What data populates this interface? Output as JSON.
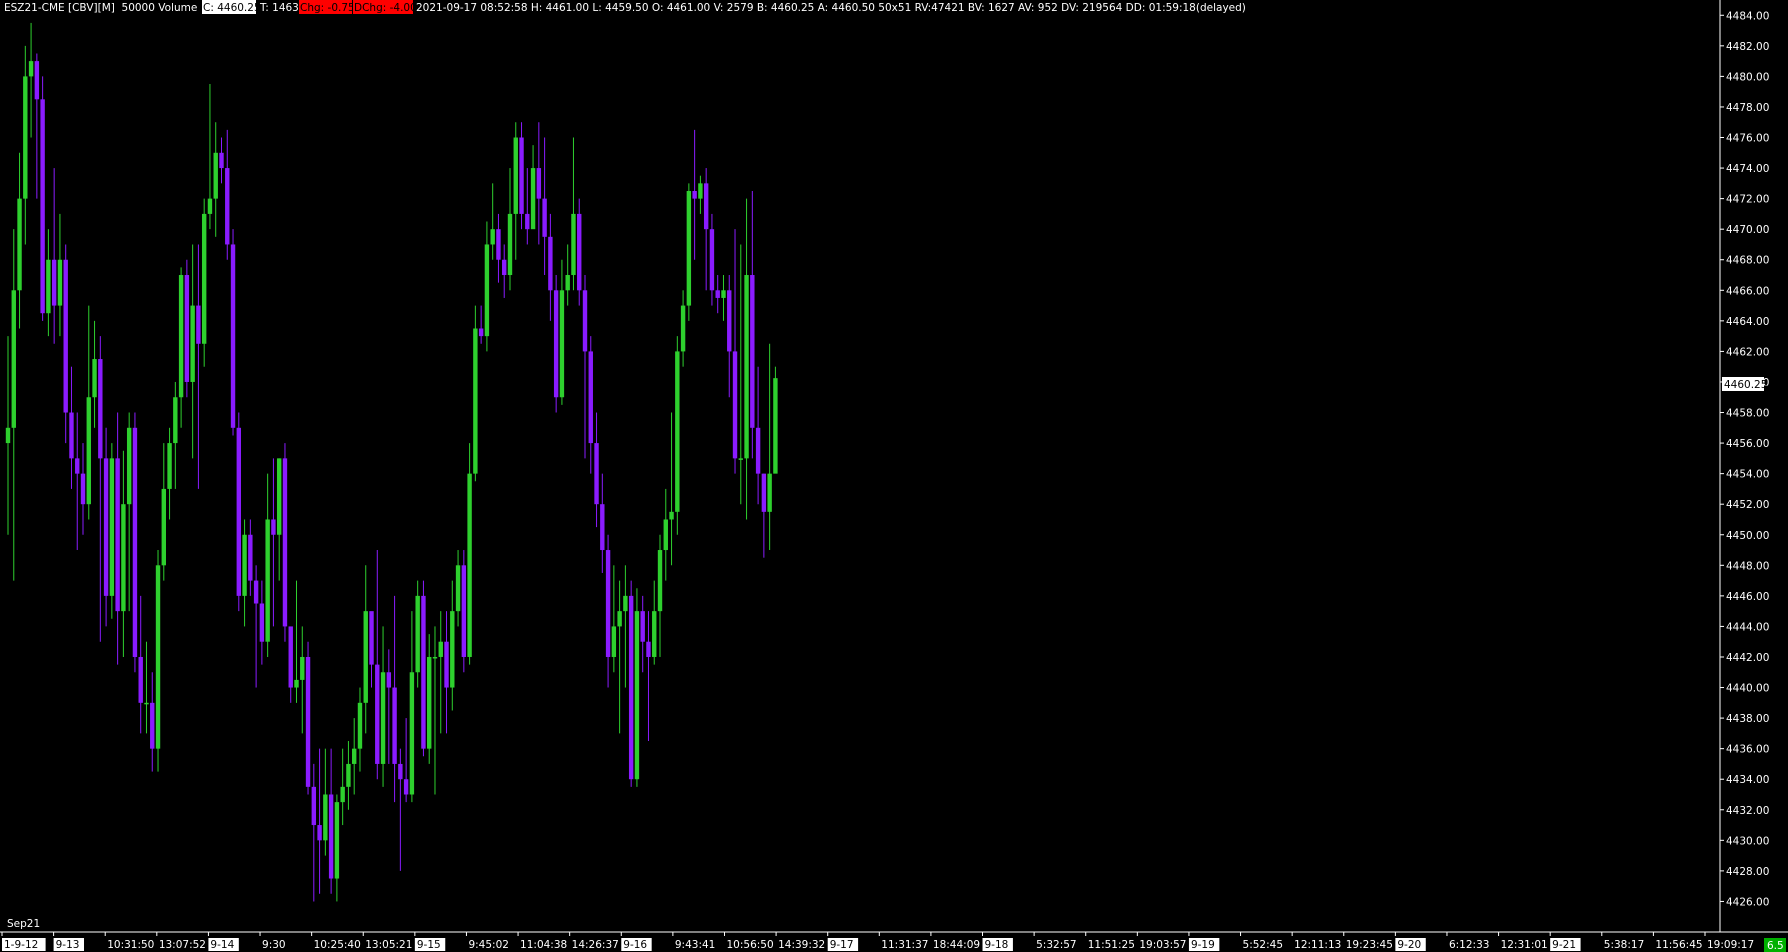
{
  "header": {
    "symbol": "ESZ21-CME [CBV][M]  50000 Volume  #3",
    "last": "C: 4460.25",
    "trades": "T: 1463",
    "chg": "Chg: -0.75",
    "dchg": "DChg: -4.00",
    "details": "2021-09-17 08:52:58 H: 4461.00 L: 4459.50 O: 4461.00 V: 2579 B: 4460.25 A: 4460.50 50x51 RV:47421 BV: 1627 AV: 952 DV: 219564 DD: 01:59:18(delayed)"
  },
  "contract_label": "Sep21",
  "colors": {
    "background": "#000000",
    "up_candle": "#2ed02e",
    "down_candle": "#8a1cff",
    "text": "#ffffff",
    "highlight": "#ff0000",
    "label_bg": "#ffffff",
    "corner_badge": "#00b000"
  },
  "current_price_label": "4460.25",
  "corner_badge_text": "6.5",
  "chart_data": {
    "type": "candlestick",
    "ylim": [
      4424,
      4485
    ],
    "y_ticks": [
      "4484.00",
      "4482.00",
      "4480.00",
      "4478.00",
      "4476.00",
      "4474.00",
      "4472.00",
      "4470.00",
      "4468.00",
      "4466.00",
      "4464.00",
      "4462.00",
      "4460.00",
      "4458.00",
      "4456.00",
      "4454.00",
      "4452.00",
      "4450.00",
      "4448.00",
      "4446.00",
      "4444.00",
      "4442.00",
      "4440.00",
      "4438.00",
      "4436.00",
      "4434.00",
      "4432.00",
      "4430.00",
      "4428.00",
      "4426.00"
    ],
    "x_ticks": [
      {
        "label": "1-9-12",
        "date": true
      },
      {
        "label": "9-13",
        "date": true
      },
      {
        "label": "10:31:50",
        "date": false
      },
      {
        "label": "13:07:52",
        "date": false
      },
      {
        "label": "9-14",
        "date": true
      },
      {
        "label": "9:30",
        "date": false
      },
      {
        "label": "10:25:40",
        "date": false
      },
      {
        "label": "13:05:21",
        "date": false
      },
      {
        "label": "9-15",
        "date": true
      },
      {
        "label": "9:45:02",
        "date": false
      },
      {
        "label": "11:04:38",
        "date": false
      },
      {
        "label": "14:26:37",
        "date": false
      },
      {
        "label": "9-16",
        "date": true
      },
      {
        "label": "9:43:41",
        "date": false
      },
      {
        "label": "10:56:50",
        "date": false
      },
      {
        "label": "14:39:32",
        "date": false
      },
      {
        "label": "9-17",
        "date": true
      },
      {
        "label": "11:31:37",
        "date": false
      },
      {
        "label": "18:44:09",
        "date": false
      },
      {
        "label": "9-18",
        "date": true
      },
      {
        "label": "5:32:57",
        "date": false
      },
      {
        "label": "11:51:25",
        "date": false
      },
      {
        "label": "19:03:57",
        "date": false
      },
      {
        "label": "9-19",
        "date": true
      },
      {
        "label": "5:52:45",
        "date": false
      },
      {
        "label": "12:11:13",
        "date": false
      },
      {
        "label": "19:23:45",
        "date": false
      },
      {
        "label": "9-20",
        "date": true
      },
      {
        "label": "6:12:33",
        "date": false
      },
      {
        "label": "12:31:01",
        "date": false
      },
      {
        "label": "9-21",
        "date": true
      },
      {
        "label": "5:38:17",
        "date": false
      },
      {
        "label": "11:56:45",
        "date": false
      },
      {
        "label": "19:09:17",
        "date": false
      }
    ],
    "candles": [
      [
        4456.0,
        4457.0,
        4450.0,
        4463.0
      ],
      [
        4457.0,
        4466.0,
        4447.0,
        4470.0
      ],
      [
        4466.0,
        4472.0,
        4463.5,
        4475.0
      ],
      [
        4472.0,
        4480.0,
        4469.0,
        4482.0
      ],
      [
        4480.0,
        4481.0,
        4476.0,
        4483.5
      ],
      [
        4481.0,
        4478.5,
        4472.0,
        4481.5
      ],
      [
        4478.5,
        4464.5,
        4464.0,
        4480.0
      ],
      [
        4464.5,
        4468.0,
        4463.0,
        4470.0
      ],
      [
        4468.0,
        4465.0,
        4462.5,
        4474.0
      ],
      [
        4465.0,
        4468.0,
        4463.0,
        4471.0
      ],
      [
        4468.0,
        4458.0,
        4456.0,
        4469.0
      ],
      [
        4458.0,
        4455.0,
        4453.0,
        4461.0
      ],
      [
        4455.0,
        4454.0,
        4449.0,
        4458.0
      ],
      [
        4454.0,
        4452.0,
        4450.0,
        4456.0
      ],
      [
        4452.0,
        4459.0,
        4451.0,
        4465.0
      ],
      [
        4459.0,
        4461.5,
        4457.0,
        4464.0
      ],
      [
        4461.5,
        4455.0,
        4443.0,
        4463.0
      ],
      [
        4455.0,
        4446.0,
        4444.0,
        4457.0
      ],
      [
        4446.0,
        4455.0,
        4444.5,
        4456.0
      ],
      [
        4455.0,
        4445.0,
        4441.5,
        4458.0
      ],
      [
        4445.0,
        4452.0,
        4442.0,
        4455.5
      ],
      [
        4452.0,
        4457.0,
        4445.0,
        4458.0
      ],
      [
        4457.0,
        4442.0,
        4441.0,
        4458.0
      ],
      [
        4442.0,
        4439.0,
        4437.0,
        4446.0
      ],
      [
        4439.0,
        4439.0,
        4437.0,
        4443.0
      ],
      [
        4439.0,
        4436.0,
        4434.5,
        4441.0
      ],
      [
        4436.0,
        4448.0,
        4434.5,
        4449.0
      ],
      [
        4448.0,
        4453.0,
        4447.0,
        4456.0
      ],
      [
        4453.0,
        4456.0,
        4451.0,
        4457.0
      ],
      [
        4456.0,
        4459.0,
        4453.0,
        4460.0
      ],
      [
        4459.0,
        4467.0,
        4457.0,
        4467.5
      ],
      [
        4467.0,
        4460.0,
        4459.0,
        4468.0
      ],
      [
        4460.0,
        4465.0,
        4455.0,
        4469.0
      ],
      [
        4465.0,
        4462.5,
        4453.0,
        4469.0
      ],
      [
        4462.5,
        4471.0,
        4461.0,
        4472.0
      ],
      [
        4471.0,
        4472.0,
        4470.0,
        4479.5
      ],
      [
        4472.0,
        4475.0,
        4469.5,
        4477.0
      ],
      [
        4475.0,
        4474.0,
        4473.0,
        4476.0
      ],
      [
        4474.0,
        4469.0,
        4468.0,
        4476.5
      ],
      [
        4469.0,
        4457.0,
        4456.5,
        4470.0
      ],
      [
        4457.0,
        4446.0,
        4445.0,
        4458.0
      ],
      [
        4446.0,
        4450.0,
        4444.0,
        4451.0
      ],
      [
        4450.0,
        4447.0,
        4446.0,
        4451.0
      ],
      [
        4447.0,
        4445.5,
        4440.0,
        4448.0
      ],
      [
        4445.5,
        4443.0,
        4441.5,
        4447.0
      ],
      [
        4443.0,
        4451.0,
        4442.0,
        4454.0
      ],
      [
        4451.0,
        4450.0,
        4444.0,
        4455.0
      ],
      [
        4450.0,
        4455.0,
        4447.0,
        4455.0
      ],
      [
        4455.0,
        4444.0,
        4443.0,
        4456.0
      ],
      [
        4444.0,
        4440.0,
        4439.0,
        4442.0
      ],
      [
        4440.0,
        4440.5,
        4439.0,
        4447.0
      ],
      [
        4440.5,
        4442.0,
        4437.0,
        4444.0
      ],
      [
        4442.0,
        4433.5,
        4433.0,
        4443.0
      ],
      [
        4433.5,
        4431.0,
        4426.0,
        4435.0
      ],
      [
        4431.0,
        4430.0,
        4426.5,
        4436.0
      ],
      [
        4430.0,
        4433.0,
        4429.0,
        4436.0
      ],
      [
        4433.0,
        4427.5,
        4426.5,
        4436.0
      ],
      [
        4427.5,
        4432.5,
        4426.0,
        4433.0
      ],
      [
        4432.5,
        4433.5,
        4431.0,
        4436.0
      ],
      [
        4433.5,
        4435.0,
        4432.0,
        4436.5
      ],
      [
        4435.0,
        4436.0,
        4433.0,
        4438.0
      ],
      [
        4436.0,
        4439.0,
        4434.5,
        4440.0
      ],
      [
        4439.0,
        4445.0,
        4437.0,
        4448.0
      ],
      [
        4445.0,
        4441.5,
        4440.0,
        4444.0
      ],
      [
        4441.5,
        4435.0,
        4434.0,
        4449.0
      ],
      [
        4435.0,
        4441.0,
        4433.5,
        4444.0
      ],
      [
        4441.0,
        4440.0,
        4435.0,
        4442.5
      ],
      [
        4440.0,
        4435.0,
        4432.5,
        4446.0
      ],
      [
        4435.0,
        4434.0,
        4428.0,
        4436.0
      ],
      [
        4434.0,
        4433.0,
        4432.5,
        4438.0
      ],
      [
        4433.0,
        4441.0,
        4432.5,
        4445.0
      ],
      [
        4441.0,
        4446.0,
        4440.0,
        4447.0
      ],
      [
        4446.0,
        4436.0,
        4435.5,
        4447.0
      ],
      [
        4436.0,
        4442.0,
        4435.0,
        4443.5
      ],
      [
        4442.0,
        4442.0,
        4433.0,
        4444.0
      ],
      [
        4442.0,
        4443.0,
        4437.0,
        4445.0
      ],
      [
        4443.0,
        4440.0,
        4437.0,
        4445.0
      ],
      [
        4440.0,
        4445.0,
        4438.5,
        4447.0
      ],
      [
        4445.0,
        4448.0,
        4444.0,
        4449.0
      ],
      [
        4448.0,
        4442.0,
        4441.0,
        4449.0
      ],
      [
        4442.0,
        4454.0,
        4441.5,
        4456.0
      ],
      [
        4454.0,
        4463.5,
        4453.5,
        4465.0
      ],
      [
        4463.5,
        4463.0,
        4462.5,
        4465.0
      ],
      [
        4463.0,
        4469.0,
        4462.0,
        4470.5
      ],
      [
        4469.0,
        4470.0,
        4468.0,
        4473.0
      ],
      [
        4470.0,
        4468.0,
        4466.5,
        4471.0
      ],
      [
        4468.0,
        4467.0,
        4465.5,
        4469.0
      ],
      [
        4467.0,
        4471.0,
        4466.0,
        4474.0
      ],
      [
        4471.0,
        4476.0,
        4468.0,
        4477.0
      ],
      [
        4476.0,
        4471.0,
        4470.0,
        4477.0
      ],
      [
        4471.0,
        4470.0,
        4469.0,
        4474.0
      ],
      [
        4470.0,
        4474.0,
        4473.0,
        4475.5
      ],
      [
        4474.0,
        4472.0,
        4469.0,
        4477.0
      ],
      [
        4472.0,
        4469.5,
        4467.0,
        4476.0
      ],
      [
        4469.5,
        4466.0,
        4464.0,
        4471.0
      ],
      [
        4466.0,
        4459.0,
        4458.0,
        4467.0
      ],
      [
        4459.0,
        4466.0,
        4458.5,
        4468.0
      ],
      [
        4466.0,
        4467.0,
        4465.0,
        4469.0
      ],
      [
        4467.0,
        4471.0,
        4466.0,
        4476.0
      ],
      [
        4471.0,
        4466.0,
        4465.0,
        4472.0
      ],
      [
        4466.0,
        4462.0,
        4455.0,
        4467.0
      ],
      [
        4462.0,
        4456.0,
        4454.0,
        4463.0
      ],
      [
        4456.0,
        4452.0,
        4450.5,
        4458.0
      ],
      [
        4452.0,
        4449.0,
        4447.5,
        4454.0
      ],
      [
        4449.0,
        4442.0,
        4440.0,
        4450.0
      ],
      [
        4442.0,
        4444.0,
        4441.0,
        4448.0
      ],
      [
        4444.0,
        4445.0,
        4437.0,
        4447.0
      ],
      [
        4445.0,
        4446.0,
        4440.0,
        4448.0
      ],
      [
        4446.0,
        4434.0,
        4433.5,
        4447.0
      ],
      [
        4434.0,
        4445.0,
        4433.5,
        4446.5
      ],
      [
        4445.0,
        4443.0,
        4441.0,
        4446.0
      ],
      [
        4443.0,
        4442.0,
        4436.5,
        4445.0
      ],
      [
        4442.0,
        4445.0,
        4441.5,
        4447.0
      ],
      [
        4445.0,
        4449.0,
        4442.0,
        4450.0
      ],
      [
        4449.0,
        4451.0,
        4447.0,
        4453.0
      ],
      [
        4451.0,
        4451.5,
        4448.0,
        4458.0
      ],
      [
        4451.5,
        4462.0,
        4450.0,
        4463.0
      ],
      [
        4462.0,
        4465.0,
        4461.0,
        4466.0
      ],
      [
        4465.0,
        4472.5,
        4464.0,
        4473.0
      ],
      [
        4472.5,
        4472.0,
        4468.0,
        4476.5
      ],
      [
        4472.0,
        4473.0,
        4471.0,
        4473.5
      ],
      [
        4473.0,
        4470.0,
        4466.0,
        4474.0
      ],
      [
        4470.0,
        4466.0,
        4465.0,
        4471.0
      ],
      [
        4466.0,
        4465.5,
        4464.5,
        4467.0
      ],
      [
        4465.5,
        4466.0,
        4464.0,
        4467.0
      ],
      [
        4466.0,
        4462.0,
        4459.0,
        4467.0
      ],
      [
        4462.0,
        4455.0,
        4454.0,
        4470.0
      ],
      [
        4455.0,
        4455.0,
        4452.0,
        4469.0
      ],
      [
        4455.0,
        4467.0,
        4451.0,
        4472.0
      ],
      [
        4467.0,
        4457.0,
        4455.0,
        4472.5
      ],
      [
        4457.0,
        4454.0,
        4452.0,
        4461.0
      ],
      [
        4454.0,
        4451.5,
        4448.5,
        4454.0
      ],
      [
        4451.5,
        4454.0,
        4449.0,
        4462.5
      ],
      [
        4454.0,
        4460.25,
        4459.5,
        4461.0
      ]
    ]
  }
}
